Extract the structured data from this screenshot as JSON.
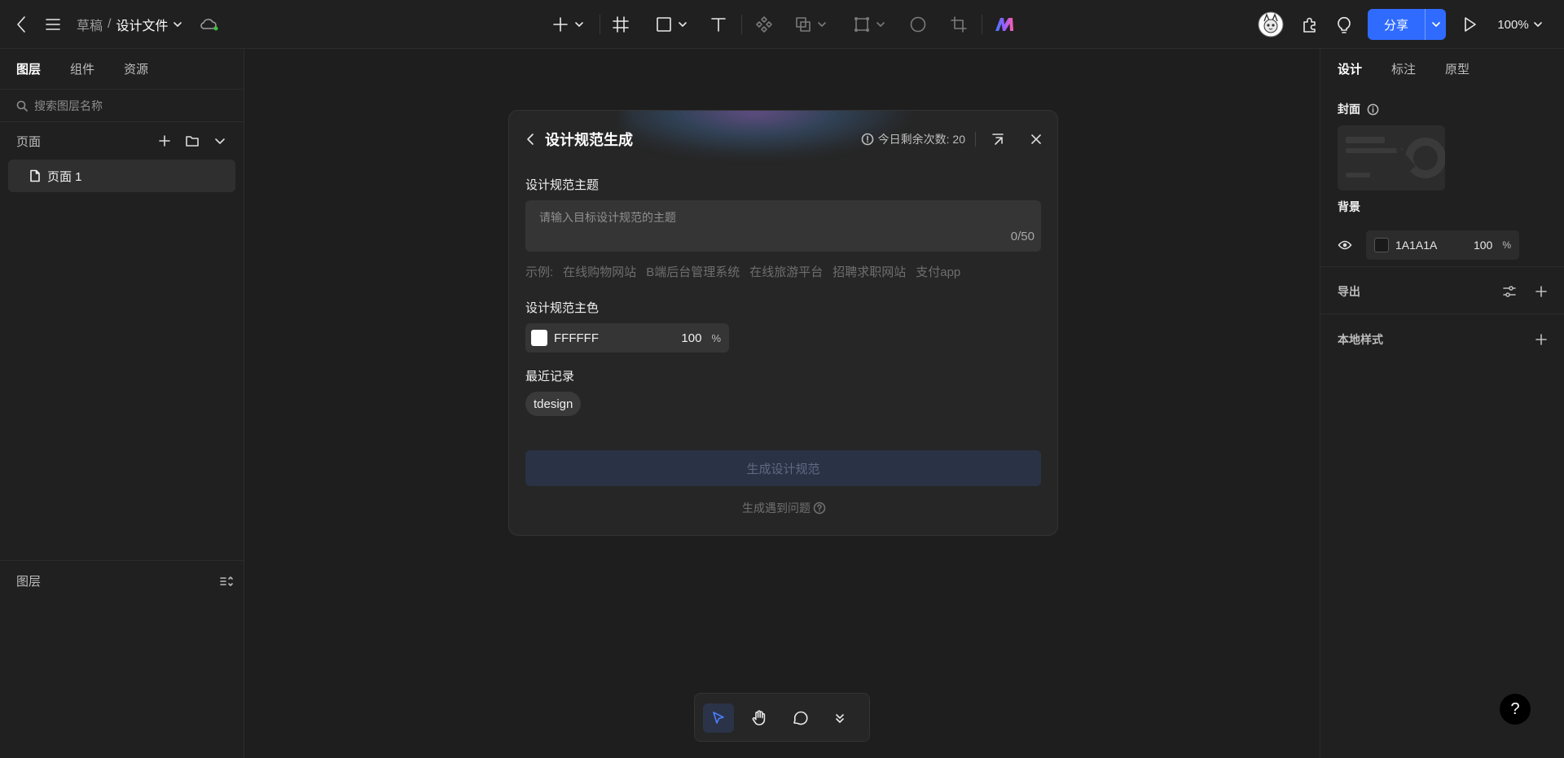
{
  "topbar": {
    "breadcrumb_parent": "草稿",
    "breadcrumb_sep": "/",
    "file_name": "设计文件",
    "share_label": "分享",
    "zoom": "100%"
  },
  "left": {
    "tabs": [
      "图层",
      "组件",
      "资源"
    ],
    "search_placeholder": "搜索图层名称",
    "pages_title": "页面",
    "pages": [
      "页面 1"
    ],
    "layers_title": "图层"
  },
  "right": {
    "tabs": [
      "设计",
      "标注",
      "原型"
    ],
    "cover_label": "封面",
    "background_label": "背景",
    "background_hex": "1A1A1A",
    "background_opacity": "100",
    "percent": "%",
    "export_label": "导出",
    "local_styles_label": "本地样式"
  },
  "modal": {
    "title": "设计规范生成",
    "quota": "今日剩余次数: 20",
    "theme_label": "设计规范主题",
    "theme_placeholder": "请输入目标设计规范的主题",
    "theme_count": "0/50",
    "examples_label": "示例:",
    "examples": [
      "在线购物网站",
      "B端后台管理系统",
      "在线旅游平台",
      "招聘求职网站",
      "支付app"
    ],
    "color_label": "设计规范主色",
    "color_hex": "FFFFFF",
    "color_opacity": "100",
    "percent": "%",
    "recent_label": "最近记录",
    "recent": [
      "tdesign"
    ],
    "generate_label": "生成设计规范",
    "help_label": "生成遇到问题"
  },
  "help_fab": "?",
  "colors": {
    "accent": "#2f6bff",
    "background": "#1a1a1a",
    "primary": "#ffffff"
  }
}
